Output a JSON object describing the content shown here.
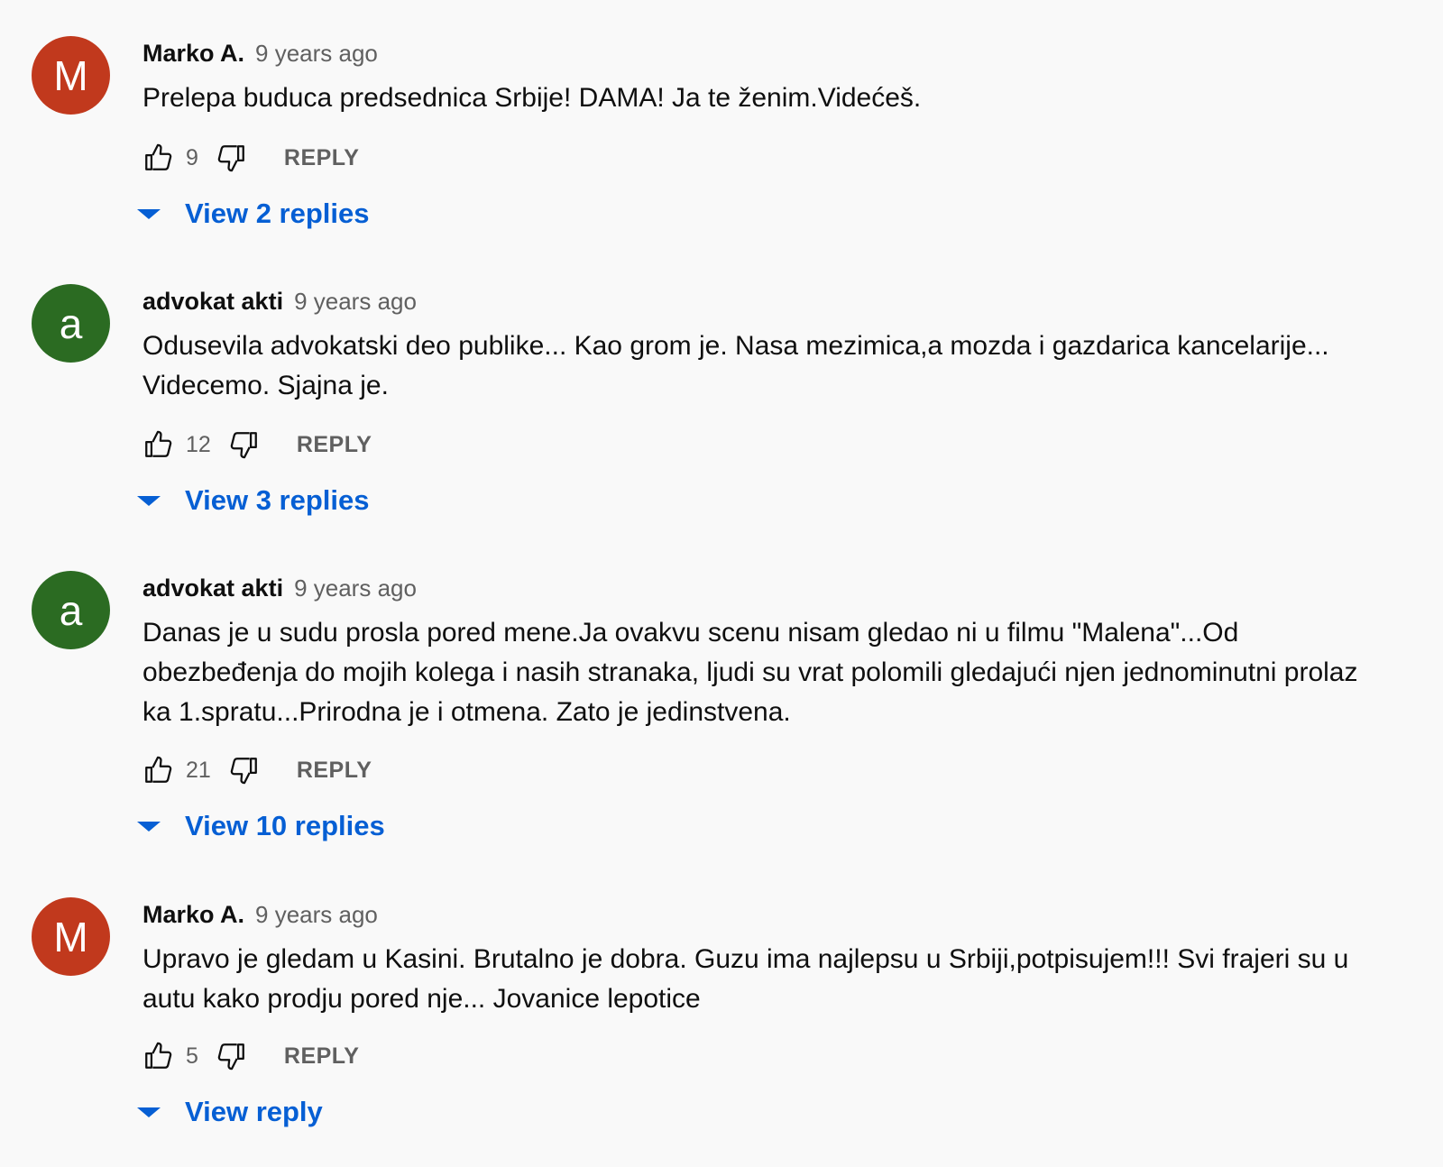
{
  "comments": [
    {
      "avatar_letter": "M",
      "avatar_color": "#c1391d",
      "author": "Marko A.",
      "time": "9 years ago",
      "text": "Prelepa buduca predsednica Srbije! DAMA! Ja te ženim.Videćeš.",
      "likes": "9",
      "reply_label": "REPLY",
      "view_replies": "View 2 replies"
    },
    {
      "avatar_letter": "a",
      "avatar_color": "#2b6b22",
      "author": "advokat akti",
      "time": "9 years ago",
      "text": "Odusevila advokatski deo publike... Kao grom je. Nasa mezimica,a mozda i gazdarica kancelarije... Videcemo. Sjajna je.",
      "likes": "12",
      "reply_label": "REPLY",
      "view_replies": "View 3 replies"
    },
    {
      "avatar_letter": "a",
      "avatar_color": "#2b6b22",
      "author": "advokat akti",
      "time": "9 years ago",
      "text": "Danas je u sudu prosla pored mene.Ja ovakvu scenu nisam gledao ni u filmu \"Malena\"...Od obezbeđenja do mojih kolega i nasih stranaka, ljudi su vrat polomili gledajući njen jednominutni prolaz ka 1.spratu...Prirodna je i otmena. Zato je jedinstvena.",
      "likes": "21",
      "reply_label": "REPLY",
      "view_replies": "View 10 replies"
    },
    {
      "avatar_letter": "M",
      "avatar_color": "#c1391d",
      "author": "Marko A.",
      "time": "9 years ago",
      "text": "Upravo je gledam u Kasini. Brutalno je dobra. Guzu ima najlepsu u Srbiji,potpisujem!!! Svi frajeri su u autu kako prodju pored nje... Jovanice lepotice",
      "likes": "5",
      "reply_label": "REPLY",
      "view_replies": "View reply"
    }
  ],
  "icons": {
    "like": "thumb-up-icon",
    "dislike": "thumb-down-icon",
    "expand": "caret-down-icon"
  },
  "colors": {
    "link_blue": "#065fd4",
    "secondary_text": "#606060",
    "background": "#f9f9f9"
  }
}
